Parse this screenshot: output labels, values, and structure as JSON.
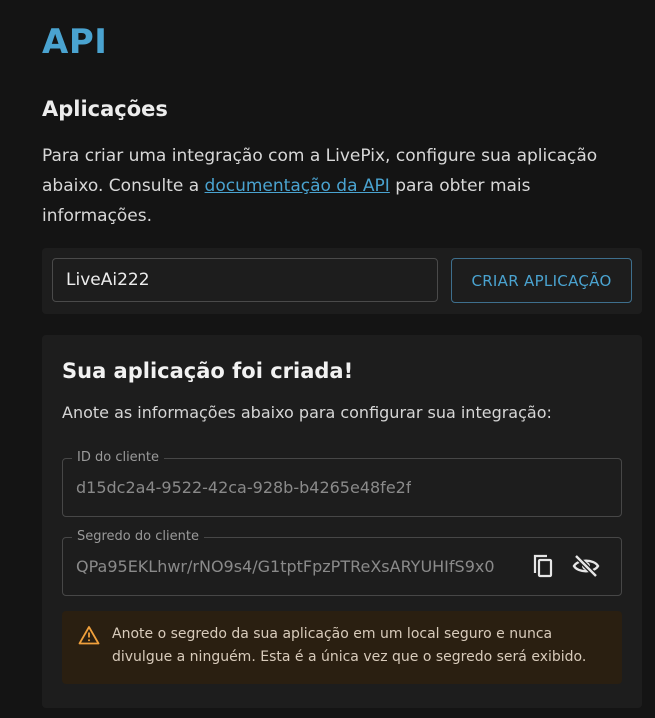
{
  "page": {
    "title": "API"
  },
  "applications": {
    "title": "Aplicações",
    "intro_before": "Para criar uma integração com a LivePix, configure sua aplicação abaixo. Consulte a ",
    "intro_link": "documentação da API",
    "intro_after": " para obter mais informações."
  },
  "create": {
    "input_value": "LiveAi222",
    "button_label": "CRIAR APLICAÇÃO"
  },
  "result": {
    "title": "Sua aplicação foi criada!",
    "description": "Anote as informações abaixo para configurar sua integração:",
    "client_id_label": "ID do cliente",
    "client_id_value": "d15dc2a4-9522-42ca-928b-b4265e48fe2f",
    "client_secret_label": "Segredo do cliente",
    "client_secret_value": "QPa95EKLhwr/rNO9s4/G1tptFpzPTReXsARYUHIfS9x0",
    "warning": "Anote o segredo da sua aplicação em um local seguro e nunca divulgue a ninguém. Esta é a única vez que o segredo será exibido."
  },
  "icons": {
    "copy": "copy-icon",
    "visibility": "eye-off-icon",
    "warning": "warning-icon"
  },
  "colors": {
    "accent": "#4aa3d0",
    "warning_bg": "#2a1f11",
    "warning_icon": "#f0a03c"
  }
}
